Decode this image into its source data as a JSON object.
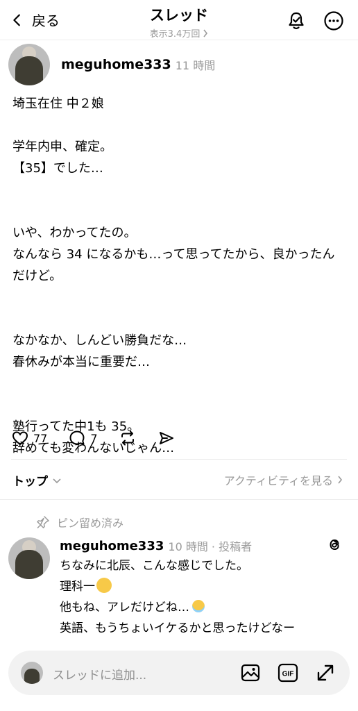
{
  "header": {
    "back_label": "戻る",
    "title": "スレッド",
    "views": "表示3.4万回"
  },
  "post": {
    "username": "meguhome333",
    "time": "11 時間",
    "lines": [
      "埼玉在住 中２娘",
      "",
      "学年内申、確定。",
      "【35】でした…",
      "",
      "",
      "いや、わかってたの。",
      "なんなら 34 になるかも…って思ってたから、良かったん",
      "だけど。",
      "",
      "",
      "なかなか、しんどい勝負だな…",
      "春休みが本当に重要だ…",
      "",
      "",
      "塾行ってた中1も 35。",
      "辞めても変わんないじゃん…"
    ],
    "likes": "77",
    "replies": "7"
  },
  "sort": {
    "label": "トップ",
    "activity_label": "アクティビティを見る"
  },
  "pinned_reply": {
    "pinned_label": "ピン留め済み",
    "username": "meguhome333",
    "meta": "10 時間 · 投稿者",
    "lines": [
      "ちなみに北辰、こんな感じでした。",
      "理科一",
      "他もね、アレだけどね…",
      "英語、もうちょいイケるかと思ったけどなー"
    ]
  },
  "composer": {
    "placeholder": "スレッドに追加..."
  },
  "icons": [
    "chevron-left-icon",
    "bell-icon",
    "more-icon",
    "heart-icon",
    "comment-icon",
    "repost-icon",
    "share-icon",
    "pin-icon",
    "threads-icon",
    "image-icon",
    "gif-icon",
    "expand-icon",
    "scream-emoji",
    "angel-emoji"
  ]
}
